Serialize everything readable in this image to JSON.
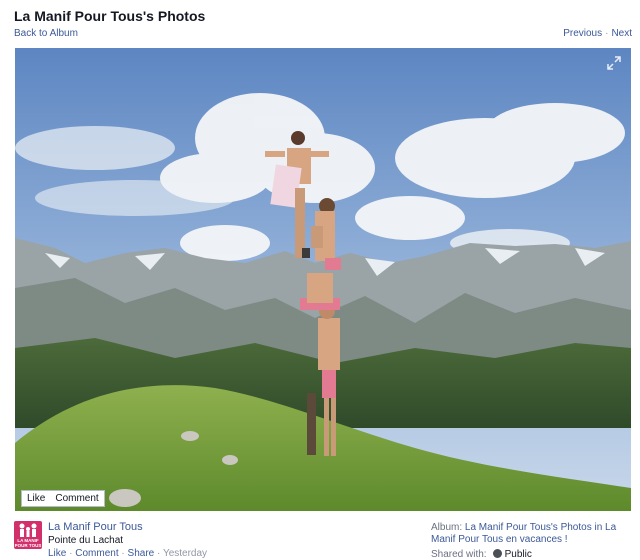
{
  "header": {
    "title": "La Manif Pour Tous's Photos",
    "back_label": "Back to Album",
    "previous_label": "Previous",
    "separator": "·",
    "next_label": "Next"
  },
  "photo": {
    "like_label": "Like",
    "comment_label": "Comment",
    "expand_icon": "expand-icon"
  },
  "footer": {
    "avatar_icon": "page-logo-avatar",
    "avatar_text": "LA MANIF POUR TOUS",
    "owner_name": "La Manif Pour Tous",
    "location": "Pointe du Lachat",
    "actions": {
      "like": "Like",
      "comment": "Comment",
      "share": "Share",
      "time": "Yesterday",
      "sep": "·"
    },
    "album_prefix": "Album:",
    "album_name": "La Manif Pour Tous's Photos in La Manif Pour Tous en vacances !",
    "shared_prefix": "Shared with:",
    "privacy": "Public",
    "privacy_icon": "globe-icon"
  },
  "colors": {
    "link": "#3b5998",
    "text": "#141823",
    "muted": "#9197a3",
    "brand_pink": "#d1306b"
  }
}
